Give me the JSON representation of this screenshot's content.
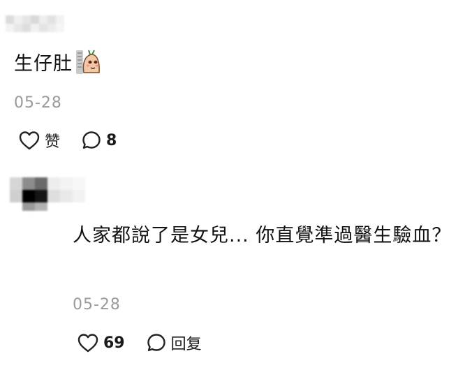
{
  "comments": [
    {
      "text": "生仔肚",
      "sticker": "peach-character-sticker",
      "date": "05-28",
      "like_label": "赞",
      "reply_count": "8"
    },
    {
      "text": "人家都說了是女兒... 你直覺準過醫生驗血？",
      "date": "05-28",
      "like_count": "69",
      "reply_label": "回复"
    }
  ],
  "icons": {
    "like": "heart-icon",
    "reply": "speech-bubble-icon"
  }
}
